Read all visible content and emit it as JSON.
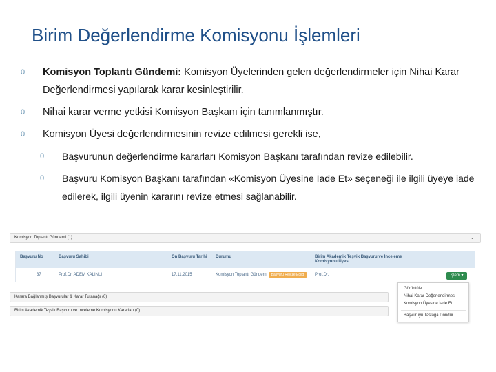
{
  "slide": {
    "title": "Birim Değerlendirme Komisyonu İşlemleri"
  },
  "bullets": [
    {
      "level": 1,
      "marker": "0",
      "bold": "Komisyon Toplantı Gündemi:",
      "text": " Komisyon Üyelerinden gelen değerlendirmeler için Nihai Karar Değerlendirmesi yapılarak karar kesinleştirilir."
    },
    {
      "level": 1,
      "marker": "0",
      "bold": "",
      "text": "Nihai karar verme yetkisi Komisyon Başkanı için tanımlanmıştır."
    },
    {
      "level": 1,
      "marker": "0",
      "bold": "",
      "text": "Komisyon Üyesi değerlendirmesinin revize edilmesi gerekli ise,"
    },
    {
      "level": 2,
      "marker": "0",
      "bold": "",
      "text": "Başvurunun değerlendirme kararları Komisyon Başkanı tarafından revize edilebilir."
    },
    {
      "level": 2,
      "marker": "0",
      "bold": "",
      "text": "Başvuru Komisyon Başkanı tarafından «Komisyon Üyesine İade Et» seçeneği ile ilgili üyeye iade edilerek, ilgili üyenin kararını revize etmesi sağlanabilir."
    }
  ],
  "screenshot": {
    "panels": [
      {
        "label": "Komisyon Toplantı Gündemi (1)"
      },
      {
        "label": "Karara Bağlanmış Başvurular & Karar Tutanağı (0)"
      },
      {
        "label": "Birim Akademik Teşvik Başvuru ve İnceleme Komisyonu Kararları (0)"
      }
    ],
    "table": {
      "headers": [
        "Başvuru No",
        "Başvuru Sahibi",
        "Ön Başvuru Tarihi",
        "Durumu",
        "Birim Akademik Teşvik Başvuru ve İnceleme Komisyonu Üyesi"
      ],
      "row": [
        "37",
        "Prof.Dr. ADEM KALINLI",
        "17.11.2015",
        "Komisyon Toplantı Gündemi",
        "Prof.Dr."
      ],
      "status_badge": "Başvuru Revize Edildi"
    },
    "action_button": "İşlem ▾",
    "menu_items": [
      "Görüntüle",
      "Nihai Karar Değerlendirmesi",
      "Komisyon Üyesine İade Et",
      "Başvuruyu Taslağa Döndür"
    ]
  }
}
